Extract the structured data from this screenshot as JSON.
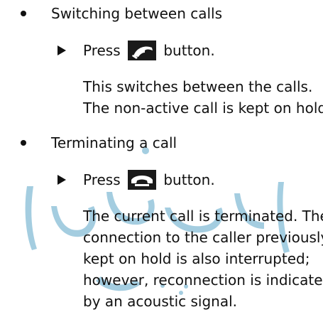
{
  "colors": {
    "text": "#111111",
    "watermark": "#5aa6c8"
  },
  "sections": [
    {
      "heading": "Switching between calls",
      "step": {
        "pre": "Press",
        "icon": "phone-accept-icon",
        "post": "button."
      },
      "paragraph_lines": [
        "This switches between the calls.",
        "The non-active call is kept on hold."
      ]
    },
    {
      "heading": "Terminating a call",
      "step": {
        "pre": "Press",
        "icon": "phone-hangup-icon",
        "post": "button."
      },
      "paragraph_lines": [
        "The current call is terminated. The",
        "connection to the caller previously",
        "kept on hold is also interrupted;",
        "however, reconnection is indicated",
        "by an acoustic signal."
      ]
    }
  ]
}
